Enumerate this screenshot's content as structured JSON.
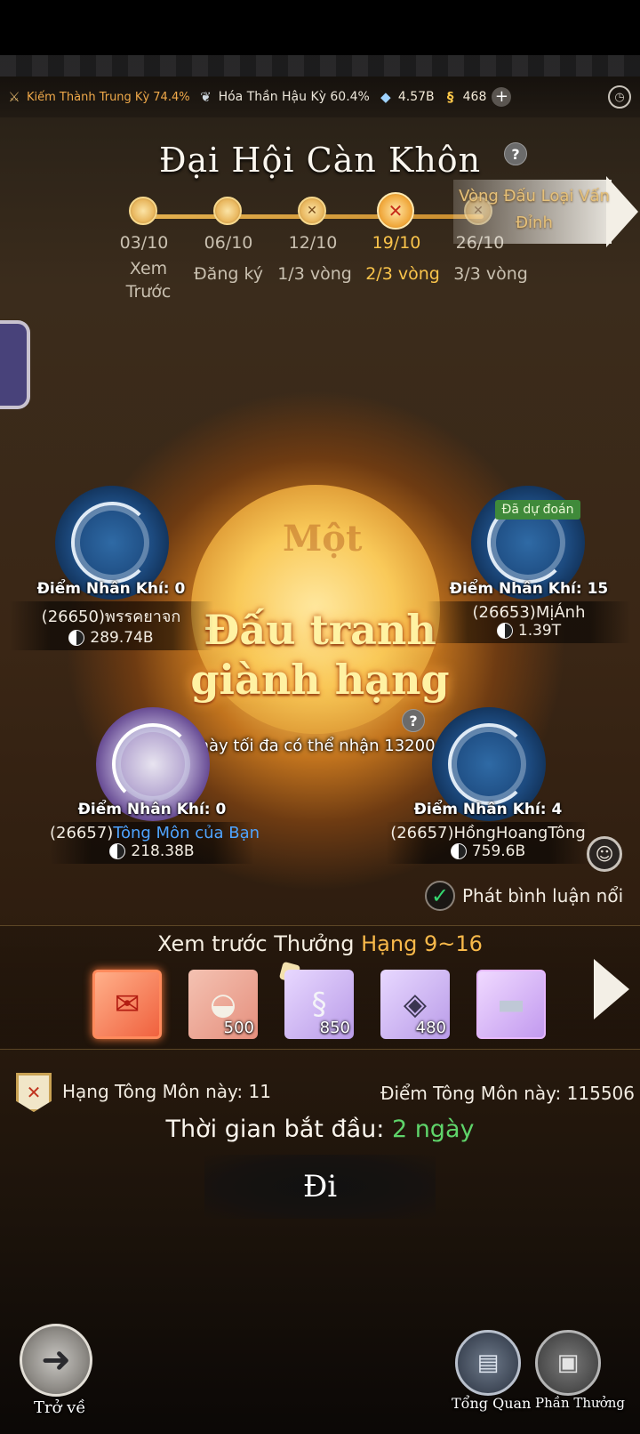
{
  "resources": {
    "realm1": "Kiếm Thành Trung Kỳ 74.4%",
    "realm2": "Hóa Thần Hậu Kỳ 60.4%",
    "gems": "4.57B",
    "coins": "468",
    "icons": [
      "sword-icon",
      "fan-icon",
      "crystal-icon",
      "coin-icon",
      "plus-icon",
      "clock-icon"
    ]
  },
  "title": "Đại Hội Càn Khôn",
  "timeline": {
    "dates": [
      "03/10",
      "06/10",
      "12/10",
      "19/10",
      "26/10"
    ],
    "stages": [
      "Xem Trước",
      "Đăng ký",
      "1/3 vòng",
      "2/3 vòng",
      "3/3 vòng"
    ],
    "active_index": 3,
    "next_stage": "Vòng Đấu Loại Vấn Đỉnh"
  },
  "center": {
    "title_line1": "Đấu tranh",
    "title_line2": "giành hạng",
    "ghost_text": "Một",
    "tip": "Trận này tối đa có thể nhận 13200 điểm"
  },
  "players": [
    {
      "score": "Điểm Nhân Khí: 0",
      "name": "(26650)พรรคยาจก",
      "power": "289.74B"
    },
    {
      "score": "Điểm Nhân Khí: 15",
      "name": "(26653)MịÁnh",
      "power": "1.39T",
      "badge": "Đã dự đoán"
    },
    {
      "score": "Điểm Nhân Khí: 0",
      "name_prefix": "(26657)",
      "name_own": "Tông Môn của Bạn",
      "power": "218.38B"
    },
    {
      "score": "Điểm Nhân Khí: 4",
      "name": "(26657)HồngHoangTông",
      "power": "759.6B"
    }
  ],
  "comments_label": "Phát bình luận nổi",
  "reward": {
    "title_prefix": "Xem trước Thưởng",
    "title_rank": "Hạng 9~16",
    "items": [
      {
        "icon": "envelope-icon",
        "count": ""
      },
      {
        "icon": "ingot-icon",
        "count": "500"
      },
      {
        "icon": "jade-pendant-icon",
        "count": "850"
      },
      {
        "icon": "scroll-icon",
        "count": "480"
      },
      {
        "icon": "token-icon",
        "count": ""
      }
    ]
  },
  "clan": {
    "rank": "Hạng Tông Môn này: 11",
    "points": "Điểm Tông Môn này: 115506"
  },
  "start": {
    "label": "Thời gian bắt đầu:",
    "value": "2 ngày"
  },
  "go_label": "Đi",
  "nav": {
    "back": "Trở về",
    "overview": "Tổng Quan",
    "reward": "Phần Thưởng"
  },
  "colors": {
    "accent": "#fac44b",
    "highlight_green": "#5fd46a",
    "own_clan_blue": "#4fa4ff"
  }
}
